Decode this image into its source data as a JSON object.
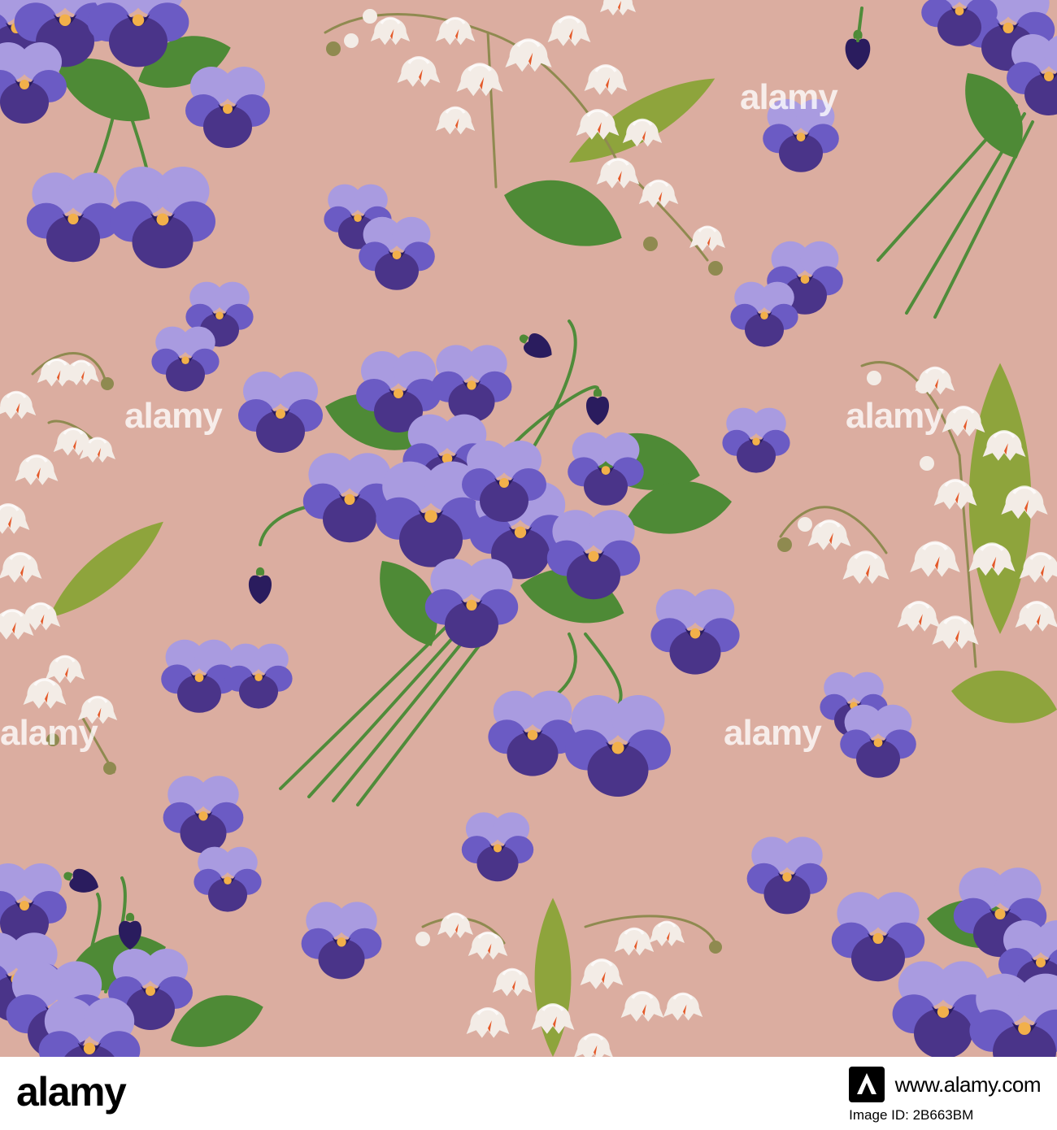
{
  "palette": {
    "background": "#dbada0",
    "violet_dark": "#4a3489",
    "violet_mid": "#6b5bc4",
    "violet_light": "#a99be0",
    "violet_center": "#2a1c5e",
    "violet_eye": "#f2b04a",
    "leaf": "#4e8a36",
    "leaf_light": "#8ea43c",
    "bell": "#f3ece6",
    "bell_shadow": "#d9e2d8",
    "bell_tip": "#e45a2a",
    "stem": "#4f8c3a"
  },
  "watermark": {
    "text": "alamy"
  },
  "footer": {
    "logo": "alamy",
    "logo_icon": "alamy-a-logo-icon",
    "site": "www.alamy.com",
    "image_id": "Image ID: 2B663BM"
  }
}
